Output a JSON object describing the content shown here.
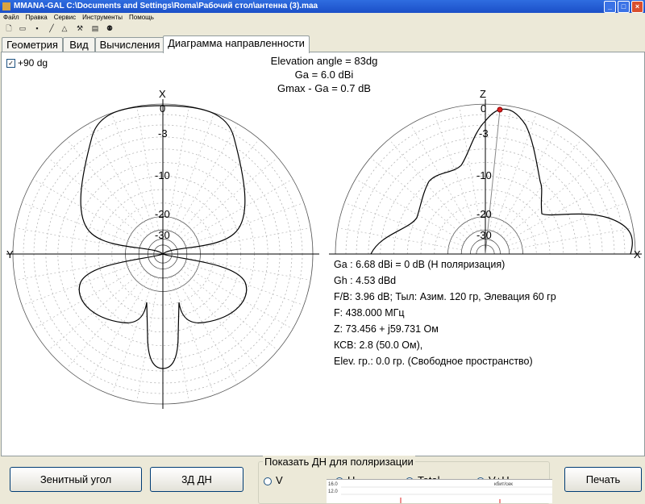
{
  "window": {
    "title": "MMANA-GAL C:\\Documents and Settings\\Roma\\Рабочий стол\\антенна (3).maa"
  },
  "menu": [
    "Файл",
    "Правка",
    "Сервис",
    "Инструменты",
    "Помощь"
  ],
  "toolbar": [
    "new-file-icon",
    "open-folder-icon",
    "save-icon",
    "wire-tool-icon",
    "triangle-tool-icon",
    "tools-icon",
    "calculator-icon",
    "users-icon"
  ],
  "tabs": [
    {
      "label": "Геометрия",
      "active": false
    },
    {
      "label": "Вид",
      "active": false
    },
    {
      "label": "Вычисления",
      "active": false
    },
    {
      "label": "Диаграмма направленности",
      "active": true
    }
  ],
  "checkbox": {
    "label": "+90 dg",
    "checked": true
  },
  "header": {
    "elevation": "Elevation angle =  83dg",
    "ga": "Ga = 6.0 dBi",
    "gmax": "Gmax - Ga = 0.7 dB"
  },
  "azimuth_plot": {
    "top_axis": "X",
    "left_axis": "Y",
    "ring_labels": [
      "0",
      "-3",
      "-10",
      "-20",
      "-30"
    ]
  },
  "elevation_plot": {
    "top_axis": "Z",
    "right_axis": "X",
    "ring_labels": [
      "0",
      "-3",
      "-10",
      "-20",
      "-30"
    ]
  },
  "info": {
    "ga": "Ga : 6.68 dBi = 0 dB  (H поляризация)",
    "gh": "Gh : 4.53 dBd",
    "fb": "F/B: 3.96 dB; Тыл: Азим. 120 гр, Элевация 60 гр",
    "freq": "F: 438.000 МГц",
    "z": "Z: 73.456 + j59.731 Ом",
    "swr": "КСВ: 2.8 (50.0 Ом),",
    "ground": "Elev. гр.: 0.0 гр. (Свободное пространство)"
  },
  "buttons": {
    "zenith": "Зенитный угол",
    "threed": "3Д   ДН",
    "print": "Печать"
  },
  "polarization": {
    "title": "Показать ДН для поляризации",
    "options": [
      {
        "label": "V",
        "selected": false
      },
      {
        "label": "H",
        "selected": false
      },
      {
        "label": "Total",
        "selected": true
      },
      {
        "label": "V+H",
        "selected": false
      }
    ]
  },
  "mini_chart": {
    "ticks": [
      "16.0",
      "12.0"
    ],
    "unit": "кбит/сек"
  }
}
